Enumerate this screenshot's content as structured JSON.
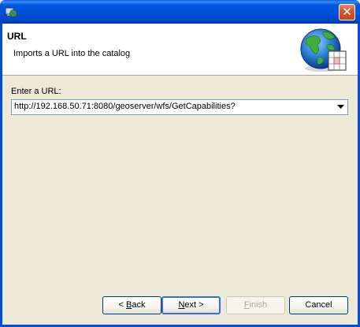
{
  "window": {
    "close_glyph": "✕"
  },
  "header": {
    "title": "URL",
    "description": "Imports a URL into the catalog"
  },
  "form": {
    "url_label": "Enter a URL:",
    "url_value": "http://192.168.50.71:8080/geoserver/wfs/GetCapabilities?"
  },
  "buttons": {
    "back_mnemonic": "B",
    "back_rest": "ack",
    "back_prefix": "< ",
    "next_mnemonic": "N",
    "next_rest": "ext >",
    "finish_mnemonic": "F",
    "finish_rest": "inish",
    "cancel": "Cancel"
  },
  "colors": {
    "titlebar": "#0054e3",
    "dialog_bg": "#ece9d8",
    "close_button": "#d9572f"
  },
  "icons": {
    "app": "app-icon",
    "header": "globe-icon",
    "combo": "chevron-down-icon",
    "close": "close-icon"
  }
}
